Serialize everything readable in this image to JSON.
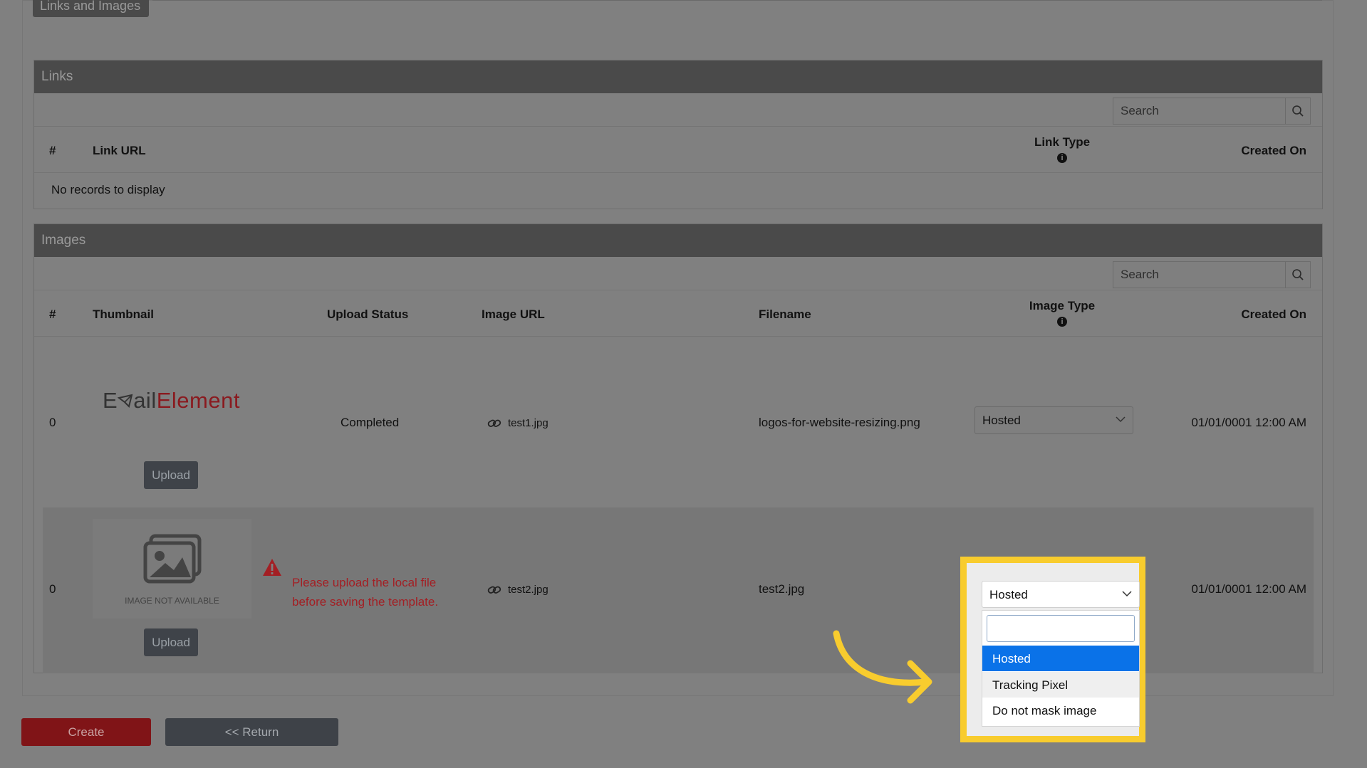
{
  "top_tab": {
    "label": "Links and Images"
  },
  "links": {
    "title": "Links",
    "search_placeholder": "Search",
    "columns": {
      "num": "#",
      "link_url": "Link URL",
      "link_type": "Link Type",
      "created_on": "Created On"
    },
    "empty_message": "No records to display"
  },
  "images": {
    "title": "Images",
    "search_placeholder": "Search",
    "columns": {
      "num": "#",
      "thumbnail": "Thumbnail",
      "upload_status": "Upload Status",
      "image_url": "Image URL",
      "filename": "Filename",
      "image_type": "Image Type",
      "created_on": "Created On"
    },
    "rows": [
      {
        "num": "0",
        "logo_text_a": "E",
        "logo_text_b": "ail",
        "logo_text_c": "Element",
        "upload_status": "Completed",
        "image_url": "test1.jpg",
        "filename": "logos-for-website-resizing.png",
        "image_type": "Hosted",
        "created_on": "01/01/0001 12:00 AM",
        "upload_label": "Upload"
      },
      {
        "num": "0",
        "placeholder_text": "IMAGE NOT AVAILABLE",
        "warning_line1": "Please upload the local file",
        "warning_line2": "before saving the template.",
        "image_url": "test2.jpg",
        "filename": "test2.jpg",
        "image_type": "Hosted",
        "created_on": "01/01/0001 12:00 AM",
        "upload_label": "Upload"
      }
    ],
    "dropdown_options": [
      "Hosted",
      "Tracking Pixel",
      "Do not mask image"
    ]
  },
  "footer": {
    "create_label": "Create",
    "return_label": "<< Return"
  },
  "colors": {
    "highlight": "#f8cc2e",
    "selected_option": "#0a72e8",
    "warning": "#a31f24"
  }
}
